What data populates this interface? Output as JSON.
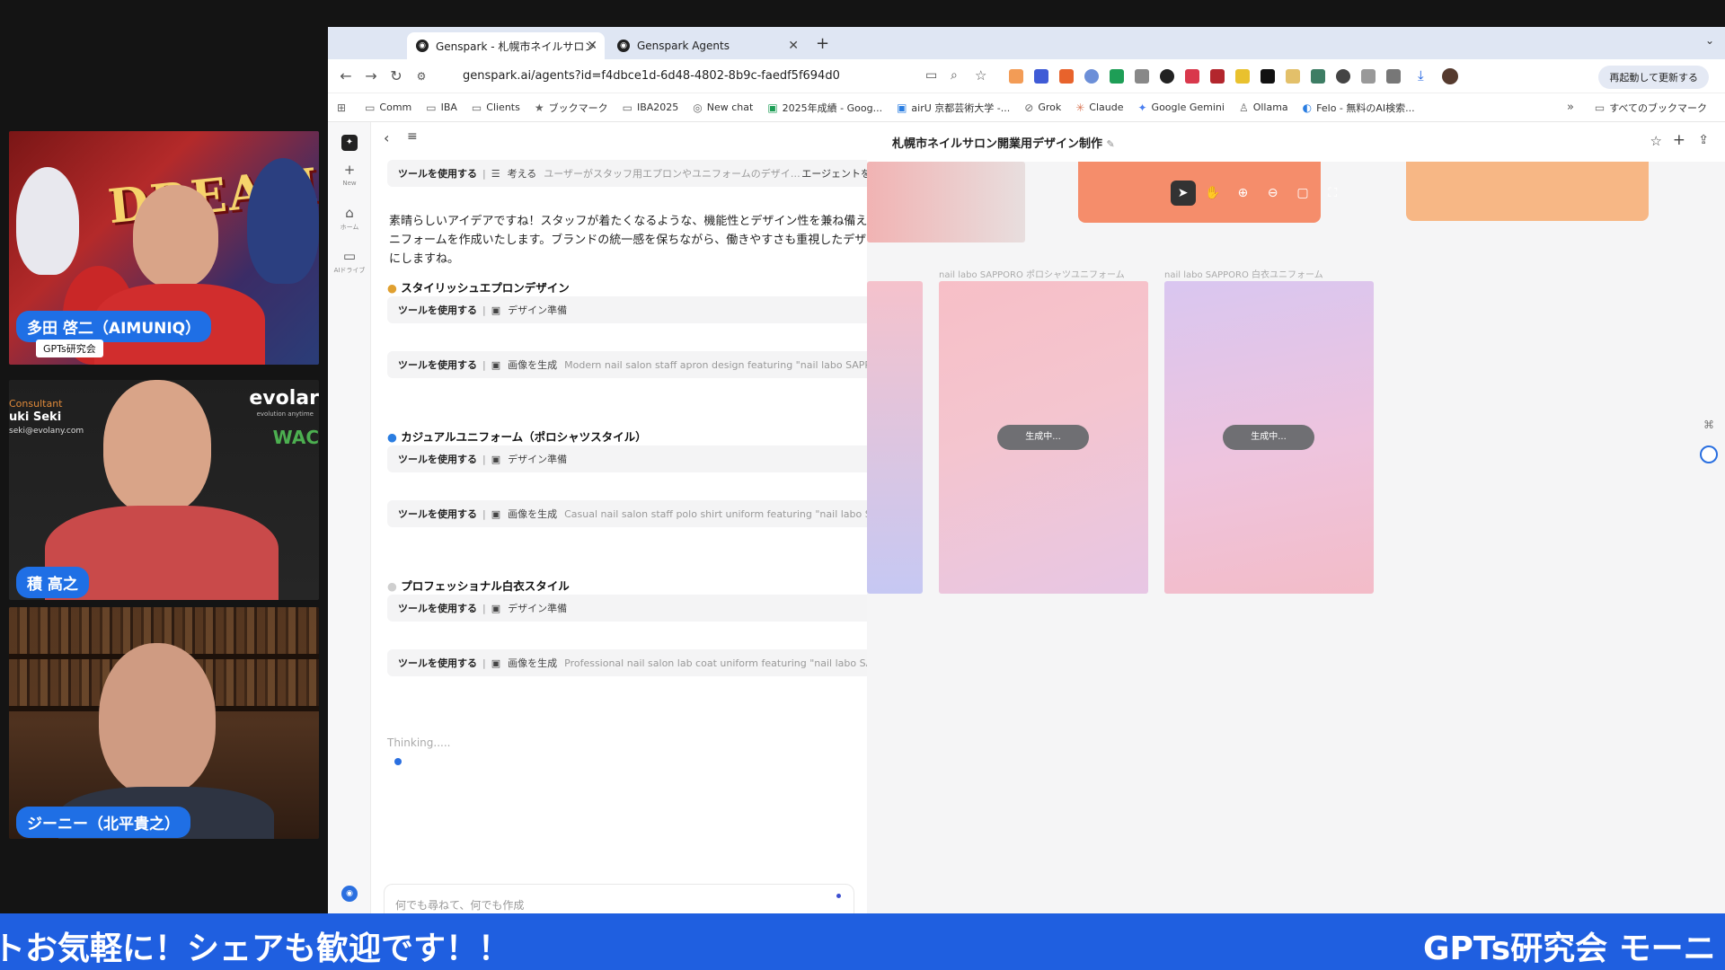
{
  "participants": [
    {
      "name": "多田 啓二（AIMUNIQ）",
      "sub": "GPTs研究会",
      "banner": "DREAMS"
    },
    {
      "name": "積 高之",
      "overlay_title": "Consultant",
      "overlay_name": "uki Seki",
      "overlay_email": "seki@evolany.com",
      "brand": "evolar",
      "brand_sub": "evolution anytime",
      "brand2": "WAC"
    },
    {
      "name": "ジーニー（北平貴之）"
    }
  ],
  "browser": {
    "tabs": [
      {
        "title": "Genspark - 札幌市ネイルサロン"
      },
      {
        "title": "Genspark Agents"
      }
    ],
    "new_tab": "+",
    "url": "genspark.ai/agents?id=f4dbce1d-6d48-4802-8b9c-faedf5f694d0",
    "relaunch_label": "再起動して更新する",
    "bookmarks": [
      "Comm",
      "IBA",
      "Clients",
      "ブックマーク",
      "IBA2025",
      "New chat",
      "2025年成績 - Goog...",
      "airU 京都芸術大学 -...",
      "Grok",
      "Claude",
      "Google Gemini",
      "Ollama",
      "Felo - 無料のAI検索..."
    ],
    "all_bookmarks": "すべてのブックマーク"
  },
  "rail": {
    "new": "New",
    "home": "ホーム",
    "drive": "AIドライブ"
  },
  "chat": {
    "first_tool": {
      "label": "ツールを使用する",
      "action": "考える",
      "desc": "ユーザーがスタッフ用エプロンやユニフォームのデザイン...",
      "button": "エージェントを表示"
    },
    "intro": "素晴らしいアイデアですね！スタッフが着たくなるような、機能性とデザイン性を兼ね備えたユニフォームを作成いたします。ブランドの統一感を保ちながら、働きやすさも重視したデザインにしますね。",
    "sections": [
      {
        "title": "スタイリッシュエプロンデザイン",
        "prep": "デザイン準備",
        "gen": "画像を生成",
        "gen_desc": "Modern nail salon staff apron design featuring \"nail labo SAPPORO\" logo e..."
      },
      {
        "title": "カジュアルユニフォーム（ポロシャツスタイル）",
        "prep": "デザイン準備",
        "gen": "画像を生成",
        "gen_desc": "Casual nail salon staff polo shirt uniform featuring \"nail labo SAPPORO\" log..."
      },
      {
        "title": "プロフェッショナル白衣スタイル",
        "prep": "デザイン準備",
        "gen": "画像を生成",
        "gen_desc": "Professional nail salon lab coat uniform featuring \"nail labo SAPPORO\" logo..."
      }
    ],
    "tool_label": "ツールを使用する",
    "thinking": "Thinking.....",
    "input_placeholder": "何でも尋ねて、何でも作成"
  },
  "canvas": {
    "title": "札幌市ネイルサロン開業用デザイン制作",
    "card1_label": "nail labo SAPPORO ポロシャツユニフォーム",
    "card2_label": "nail labo SAPPORO 白衣ユニフォーム",
    "generating": "生成中..."
  },
  "ticker": {
    "left": "トお気軽に！シェアも歓迎です！！",
    "right": "GPTs研究会 モーニ"
  }
}
